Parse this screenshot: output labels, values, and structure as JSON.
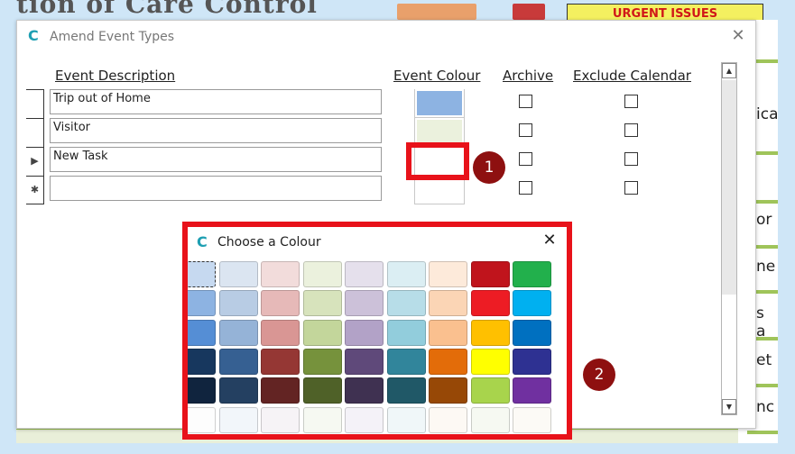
{
  "background": {
    "title_fragment": "tion of Care Control",
    "urgent_label": "URGENT ISSUES",
    "right_fragments": [
      "ica",
      "or",
      "ne",
      "s a",
      "et",
      "nc"
    ]
  },
  "dialog": {
    "icon": "app-logo-icon",
    "title": "Amend Event Types",
    "close": "✕",
    "headers": {
      "description": "Event Description",
      "colour": "Event Colour",
      "archive": "Archive",
      "exclude": "Exclude Calendar"
    },
    "rows": [
      {
        "selector": "",
        "description": "Trip out of Home",
        "colour": "#8db3e2"
      },
      {
        "selector": "",
        "description": "Visitor",
        "colour": "#ebf1dd"
      },
      {
        "selector": "▶",
        "description": "New Task",
        "colour": "#ffffff"
      },
      {
        "selector": "✱",
        "description": "",
        "colour": "#ffffff"
      }
    ],
    "scroll_up": "▲",
    "scroll_down": "▼"
  },
  "annotations": {
    "badge1": "1",
    "badge2": "2",
    "highlight_color": "#e8121a",
    "badge_color": "#8e1010"
  },
  "picker": {
    "icon": "app-logo-icon",
    "title": "Choose a Colour",
    "close": "✕",
    "swatches": [
      [
        "#c6d9f0",
        "#dbe5f1",
        "#f2dcdb",
        "#ebf1dd",
        "#e5e0ec",
        "#dbeef3",
        "#fdeada",
        "#c0141c",
        "#22b04c"
      ],
      [
        "#8db3e2",
        "#b8cce4",
        "#e6b9b8",
        "#d7e3bc",
        "#ccc1d9",
        "#b7dde8",
        "#fbd5b5",
        "#ed1c24",
        "#00b0f0"
      ],
      [
        "#558ed5",
        "#95b3d7",
        "#d99694",
        "#c3d69b",
        "#b2a2c7",
        "#92cddc",
        "#fac08f",
        "#ffc000",
        "#0070c0"
      ],
      [
        "#17375e",
        "#366092",
        "#953734",
        "#76923c",
        "#5f497a",
        "#31859b",
        "#e36c09",
        "#ffff00",
        "#2e3192"
      ],
      [
        "#10243e",
        "#244061",
        "#632423",
        "#4f6128",
        "#3f3151",
        "#205867",
        "#974806",
        "#a8d44c",
        "#7030a0"
      ],
      [
        "#fdfdfd",
        "#f2f6fa",
        "#f6f3f6",
        "#f6f9f2",
        "#f4f2f8",
        "#f0f7f9",
        "#fdf9f4",
        "#f6f9f2",
        "#fcfaf6"
      ]
    ]
  }
}
